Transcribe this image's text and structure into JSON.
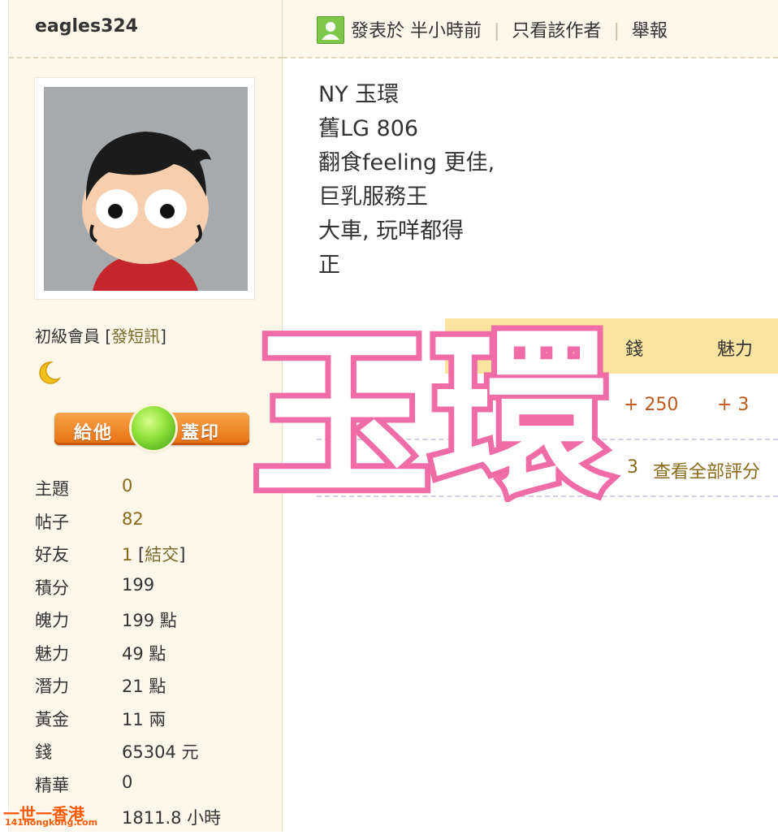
{
  "user": {
    "username": "eagles324",
    "rank": "初級會員",
    "pm_link": "發短訊",
    "stamp": {
      "left": "給他",
      "right": "蓋印"
    }
  },
  "stats": [
    {
      "label": "主題",
      "value": "0",
      "gold": true
    },
    {
      "label": "帖子",
      "value": "82",
      "gold": true
    },
    {
      "label": "好友",
      "value": "1",
      "link": "結交",
      "gold": true
    },
    {
      "label": "積分",
      "value": "199"
    },
    {
      "label": "魄力",
      "value": "199 點"
    },
    {
      "label": "魅力",
      "value": "49 點"
    },
    {
      "label": "潛力",
      "value": "21 點"
    },
    {
      "label": "黃金",
      "value": "11 兩"
    },
    {
      "label": "錢",
      "value": "65304 元"
    },
    {
      "label": "精華",
      "value": "0"
    },
    {
      "label": "",
      "value": "1811.8 小時"
    }
  ],
  "post": {
    "posted": "發表於 半小時前",
    "only_author": "只看該作者",
    "report": "舉報",
    "lines": [
      "NY 玉環",
      "舊LG 806",
      "翻食feeling 更佳,",
      "巨乳服務王",
      "大車, 玩咩都得",
      "正"
    ]
  },
  "rating": {
    "col_money": "錢",
    "col_charm": "魅力",
    "rater": "...ural",
    "money": "+ 250",
    "charm": "+ 3",
    "count": "3",
    "view_all": "查看全部評分"
  },
  "overlay_text": "玉環",
  "watermark": {
    "top": "一世一香港",
    "bottom": "141hongkong.com"
  },
  "colors": {
    "sidebar_bg": "#fdf8ea",
    "overlay_pink": "#f06ca6",
    "rating_header": "#fbe3a0",
    "stamp_orange": "#f08a2a"
  }
}
